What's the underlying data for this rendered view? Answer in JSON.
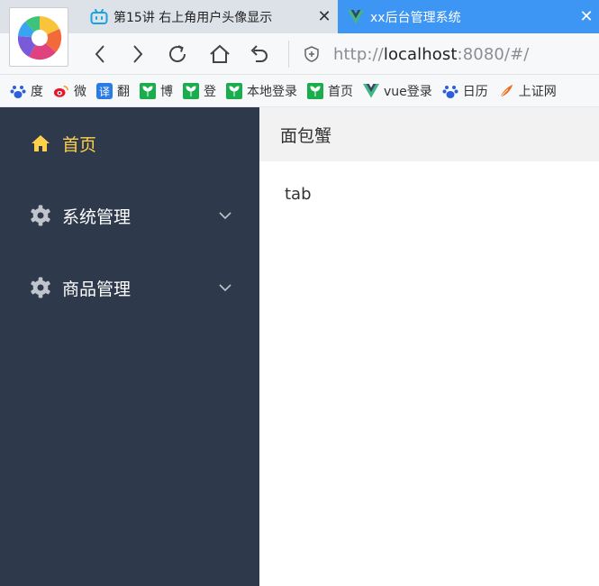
{
  "browser": {
    "tabs": [
      {
        "title": "第15讲 右上角用户头像显示",
        "active": false,
        "icon": "bilibili-icon",
        "close": "✕"
      },
      {
        "title": "xx后台管理系统",
        "active": true,
        "icon": "vue-icon",
        "close": "✕"
      }
    ],
    "url": {
      "scheme": "http://",
      "host": "localhost",
      "rest": ":8080/#/"
    },
    "bookmarks": [
      {
        "label": "度",
        "icon": "baidu-icon"
      },
      {
        "label": "微",
        "icon": "weibo-icon"
      },
      {
        "label": "翻",
        "icon": "translate-icon"
      },
      {
        "label": "博",
        "icon": "sprout-icon"
      },
      {
        "label": "登",
        "icon": "sprout-icon"
      },
      {
        "label": "本地登录",
        "icon": "sprout-icon"
      },
      {
        "label": "首页",
        "icon": "sprout-icon"
      },
      {
        "label": "vue登录",
        "icon": "vue-icon"
      },
      {
        "label": "日历",
        "icon": "baidu-icon"
      },
      {
        "label": "上证网",
        "icon": "feather-icon"
      }
    ]
  },
  "sidebar": {
    "items": [
      {
        "label": "首页",
        "icon": "home-icon",
        "active": true
      },
      {
        "label": "系统管理",
        "icon": "gear-icon",
        "expandable": true
      },
      {
        "label": "商品管理",
        "icon": "gear-icon",
        "expandable": true
      }
    ]
  },
  "header": {
    "breadcrumb": "面包蟹"
  },
  "main": {
    "tab_text": "tab"
  },
  "colors": {
    "sidebar_bg": "#2e3a4b",
    "active_menu": "#ffd04b",
    "active_tab_bg": "#3d96f4",
    "header_bg": "#f2f2f2"
  }
}
